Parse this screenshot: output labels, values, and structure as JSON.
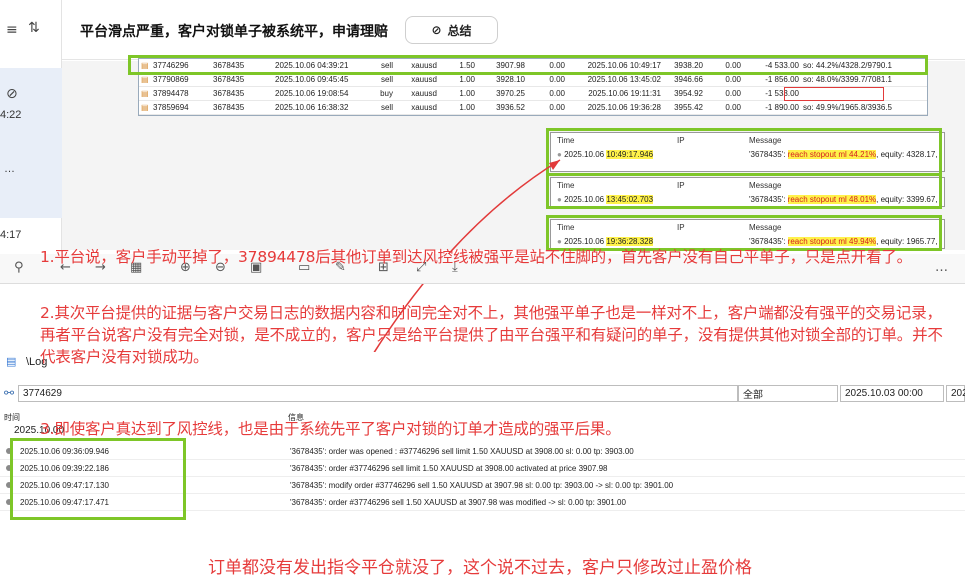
{
  "sidebar": {
    "times": [
      "4:22",
      "4:17"
    ],
    "ellipsis": "…"
  },
  "header": {
    "title": "平台滑点严重，客户对锁单子被系统平，申请理赔",
    "summary_label": "总结"
  },
  "orders": [
    {
      "ticket": "37746296",
      "login": "3678435",
      "open_time": "2025.10.06 04:39:21",
      "type": "sell",
      "symbol": "xauusd",
      "volume": "1.50",
      "open_price": "3907.98",
      "sl": "0.00",
      "close_time": "2025.10.06 10:49:17",
      "close_price": "3938.20",
      "tp": "0.00",
      "profit": "-4 533.00",
      "comment": "so: 44.2%/4328.2/9790.1"
    },
    {
      "ticket": "37790869",
      "login": "3678435",
      "open_time": "2025.10.06 09:45:45",
      "type": "sell",
      "symbol": "xauusd",
      "volume": "1.00",
      "open_price": "3928.10",
      "sl": "0.00",
      "close_time": "2025.10.06 13:45:02",
      "close_price": "3946.66",
      "tp": "0.00",
      "profit": "-1 856.00",
      "comment": "so: 48.0%/3399.7/7081.1"
    },
    {
      "ticket": "37894478",
      "login": "3678435",
      "open_time": "2025.10.06 19:08:54",
      "type": "buy",
      "symbol": "xauusd",
      "volume": "1.00",
      "open_price": "3970.25",
      "sl": "0.00",
      "close_time": "2025.10.06 19:11:31",
      "close_price": "3954.92",
      "tp": "0.00",
      "profit": "-1 533.00",
      "comment": ""
    },
    {
      "ticket": "37859694",
      "login": "3678435",
      "open_time": "2025.10.06 16:38:32",
      "type": "sell",
      "symbol": "xauusd",
      "volume": "1.00",
      "open_price": "3936.52",
      "sl": "0.00",
      "close_time": "2025.10.06 19:36:28",
      "close_price": "3955.42",
      "tp": "0.00",
      "profit": "-1 890.00",
      "comment": "so: 49.9%/1965.8/3936.5"
    }
  ],
  "logs": {
    "headers": {
      "time": "Time",
      "ip": "IP",
      "message": "Message"
    },
    "entries": [
      {
        "date": "2025.10.06",
        "time": "10:49:17.946",
        "account": "'3678435':",
        "reason": "reach stopout ml 44.21%",
        "rest": ", equity: 4328.17, "
      },
      {
        "date": "2025.10.06",
        "time": "13:45:02.703",
        "account": "'3678435':",
        "reason": "reach stopout ml 48.01%",
        "rest": ", equity: 3399.67, r"
      },
      {
        "date": "2025.10.06",
        "time": "19:36:28.328",
        "account": "'3678435':",
        "reason": "reach stopout ml 49.94%",
        "rest": ", equity: 1965.77, "
      }
    ]
  },
  "annotation": {
    "p1": "1.平台说，客户手动平掉了，37894478后其他订单到达风控线被强平是站不住脚的，首先客户没有自己平单子，只是点开看了。",
    "p2": "2.其次平台提供的证据与客户交易日志的数据内容和时间完全对不上，其他强平单子也是一样对不上，客户端都没有强平的交易记录，再者平台说客户没有完全对锁，是不成立的，客户只是给平台提供了由平台强平和有疑问的单子，没有提供其他对锁全部的订单。并不代表客户没有对锁成功。",
    "p3": "3.即使客户真达到了风控线，也是由于系统先平了客户对锁的订单才造成的强平后果。"
  },
  "journal": {
    "tab_label": "\\Log",
    "filter_value": "3774629",
    "select_all": "全部",
    "date_from": "2025.10.03 00:00",
    "date_to_partial": "202",
    "col_time": "时间",
    "col_info": "信息",
    "first_row_time": "2025.10.00",
    "rows": [
      {
        "time": "2025.10.06 09:36:09.946",
        "msg": "'3678435': order was opened : #37746296 sell limit 1.50 XAUUSD at 3908.00 sl: 0.00 tp: 3903.00"
      },
      {
        "time": "2025.10.06 09:39:22.186",
        "msg": "'3678435': order #37746296 sell limit 1.50 XAUUSD at 3908.00 activated at price 3907.98"
      },
      {
        "time": "2025.10.06 09:47:17.130",
        "msg": "'3678435': modify order #37746296 sell 1.50 XAUUSD at 3907.98 sl: 0.00 tp: 3903.00 -> sl: 0.00 tp: 3901.00"
      },
      {
        "time": "2025.10.06 09:47:17.471",
        "msg": "'3678435': order #37746296 sell 1.50 XAUUSD at 3907.98 was modified -> sl: 0.00 tp: 3901.00"
      }
    ]
  },
  "bottom_note": "订单都没有发出指令平仓就没了，这个说不过去，客户只修改过止盈价格",
  "colors": {
    "highlight_green": "#7ec628",
    "annotation_red": "#e63b3b",
    "yellow": "#fff24a"
  }
}
